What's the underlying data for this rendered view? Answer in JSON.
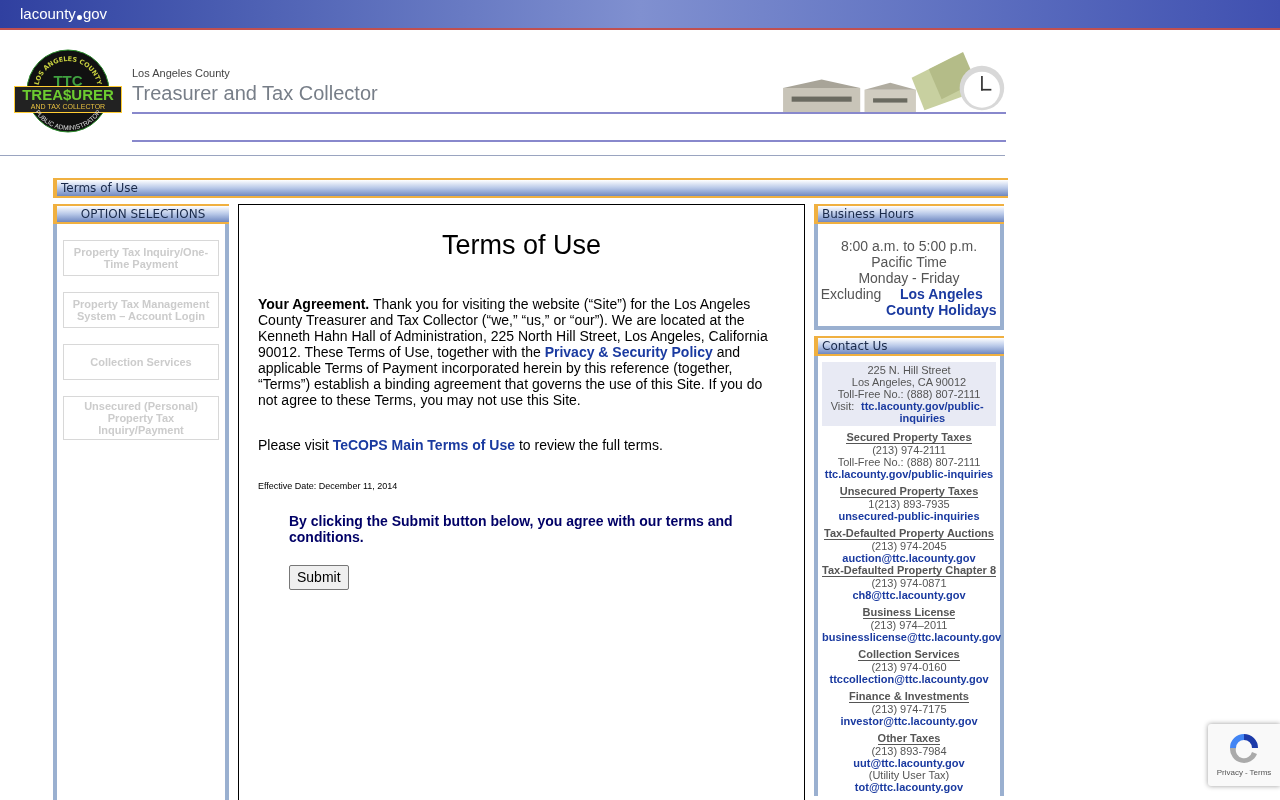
{
  "top_bar": {
    "site_left": "lacounty",
    "site_right": "gov"
  },
  "logo": {
    "ring_top": "LOS ANGELES COUNTY",
    "initials": "TTC",
    "word": "TREA$URER",
    "band": "AND TAX COLLECTOR",
    "ring_bottom": "PUBLIC ADMINISTRATOR"
  },
  "header": {
    "subtitle": "Los Angeles County",
    "title": "Treasurer and Tax Collector"
  },
  "breadcrumb": "Terms of Use",
  "sidebar": {
    "title": "OPTION SELECTIONS",
    "items": [
      {
        "label": "Property Tax Inquiry/One-Time Payment",
        "disabled": true
      },
      {
        "label": "Property Tax Management System – Account Login",
        "disabled": true
      },
      {
        "label": "Collection Services",
        "disabled": true
      },
      {
        "label": "Unsecured (Personal) Property Tax Inquiry/Payment",
        "disabled": true
      }
    ]
  },
  "main": {
    "title": "Terms of Use",
    "agreement": {
      "lead": "Your Agreement.",
      "before": "Thank you for visiting the website (“Site”) for the Los Angeles County Treasurer and Tax Collector (“we,” “us,” or “our”).  We are located at the Kenneth Hahn Hall of Administration, 225 North Hill Street, Los Angeles, California 90012.  These Terms of Use, together with the",
      "link": "Privacy & Security Policy",
      "after": "and applicable Terms of Payment incorporated herein by this reference (together, “Terms”) establish a binding agreement that governs the use of this Site.  If you do not agree to these Terms, you may not use this Site."
    },
    "visit": {
      "before": "Please visit",
      "link": "TeCOPS Main Terms of Use",
      "after": "to review the full terms."
    },
    "effective": "Effective Date: December 11, 2014",
    "consent": "By clicking the Submit button below, you agree with our terms and conditions.",
    "submit": "Submit"
  },
  "hours": {
    "title": "Business Hours",
    "lines": [
      "8:00 a.m. to 5:00 p.m.",
      "Pacific Time",
      "Monday - Friday"
    ],
    "prefix": "Excluding",
    "link": "Los Angeles County Holidays"
  },
  "contact": {
    "title": "Contact Us",
    "address": {
      "lines": [
        "225 N. Hill Street",
        "Los Angeles, CA 90012",
        "Toll-Free No.: (888) 807-2111"
      ],
      "prefix": "Visit:",
      "link": "ttc.lacounty.gov/public-inquiries"
    },
    "groups": [
      {
        "heading": "Secured Property Taxes",
        "gap": true,
        "lines": [
          {
            "kind": "text",
            "text": "(213) 974-2111"
          },
          {
            "kind": "text",
            "text": "Toll-Free No.: (888) 807-2111"
          },
          {
            "kind": "link",
            "text": "ttc.lacounty.gov/public-inquiries"
          }
        ]
      },
      {
        "heading": "Unsecured Property Taxes",
        "gap": true,
        "lines": [
          {
            "kind": "text",
            "text": "1(213) 893-7935"
          },
          {
            "kind": "link",
            "text": "unsecured-public-inquiries"
          }
        ]
      },
      {
        "heading": "Tax-Defaulted Property Auctions",
        "gap": true,
        "lines": [
          {
            "kind": "text",
            "text": "(213) 974-2045"
          },
          {
            "kind": "link",
            "text": "auction@ttc.lacounty.gov"
          }
        ]
      },
      {
        "heading": "Tax-Defaulted Property Chapter 8",
        "gap": false,
        "lines": [
          {
            "kind": "text",
            "text": "(213) 974-0871"
          },
          {
            "kind": "link",
            "text": "ch8@ttc.lacounty.gov"
          }
        ]
      },
      {
        "heading": "Business License",
        "gap": true,
        "lines": [
          {
            "kind": "text",
            "text": "(213) 974–2011"
          },
          {
            "kind": "link",
            "text": "businesslicense@ttc.lacounty.gov"
          }
        ]
      },
      {
        "heading": "Collection Services",
        "gap": true,
        "lines": [
          {
            "kind": "text",
            "text": "(213) 974-0160"
          },
          {
            "kind": "link",
            "text": "ttccollection@ttc.lacounty.gov"
          }
        ]
      },
      {
        "heading": "Finance & Investments",
        "gap": true,
        "lines": [
          {
            "kind": "text",
            "text": "(213) 974-7175"
          },
          {
            "kind": "link",
            "text": "investor@ttc.lacounty.gov"
          }
        ]
      },
      {
        "heading": "Other Taxes",
        "gap": true,
        "lines": [
          {
            "kind": "text",
            "text": "(213) 893-7984"
          },
          {
            "kind": "link",
            "text": "uut@ttc.lacounty.gov"
          },
          {
            "kind": "text",
            "text": "(Utility User Tax)"
          },
          {
            "kind": "link",
            "text": "tot@ttc.lacounty.gov"
          }
        ]
      }
    ]
  },
  "recaptcha": {
    "links": [
      "Privacy",
      "Terms"
    ],
    "separator": "-"
  }
}
